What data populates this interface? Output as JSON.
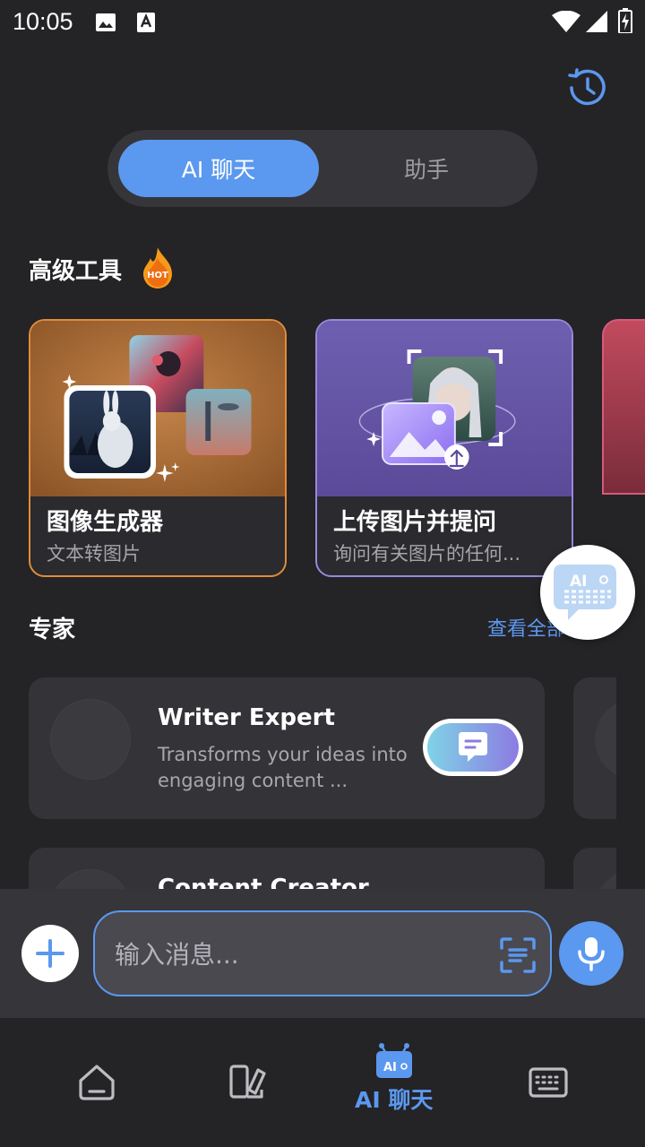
{
  "status_bar": {
    "time": "10:05"
  },
  "tabs": {
    "active": "AI 聊天",
    "inactive": "助手"
  },
  "tools_section": {
    "title": "高级工具",
    "badge": "HOT"
  },
  "tools": [
    {
      "name": "图像生成器",
      "subtitle": "文本转图片"
    },
    {
      "name": "上传图片并提问",
      "subtitle": "询问有关图片的任何..."
    }
  ],
  "experts_section": {
    "title": "专家",
    "see_all": "查看全部"
  },
  "experts": [
    {
      "name": "Writer Expert",
      "description": "Transforms your ideas into engaging content ..."
    },
    {
      "name": "Content Creator",
      "description": ""
    }
  ],
  "floating_button": {
    "label": "AI"
  },
  "input": {
    "placeholder": "输入消息..."
  },
  "bottom_nav": {
    "active_label": "AI 聊天",
    "ai_icon_text": "AI"
  },
  "colors": {
    "accent": "#5b98ef",
    "background": "#242326",
    "card": "#343337",
    "orange_border": "#e08c3a",
    "purple_border": "#9b86de"
  }
}
